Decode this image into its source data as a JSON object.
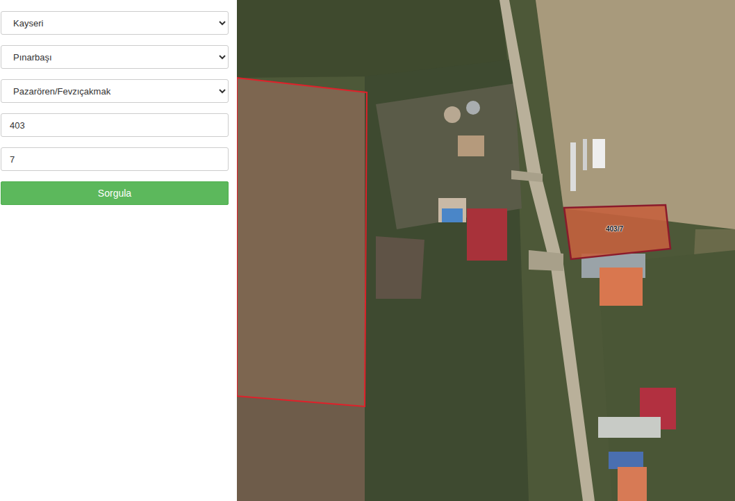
{
  "query_form": {
    "province": "Kayseri",
    "district": "Pınarbaşı",
    "neighborhood": "Pazarören/Fevzıçakmak",
    "block": "403",
    "parcel": "7",
    "submit": "Sorgula"
  },
  "map": {
    "parcels": [
      {
        "label": "403/7",
        "selected": true
      },
      {
        "label": "",
        "selected": false
      }
    ]
  }
}
